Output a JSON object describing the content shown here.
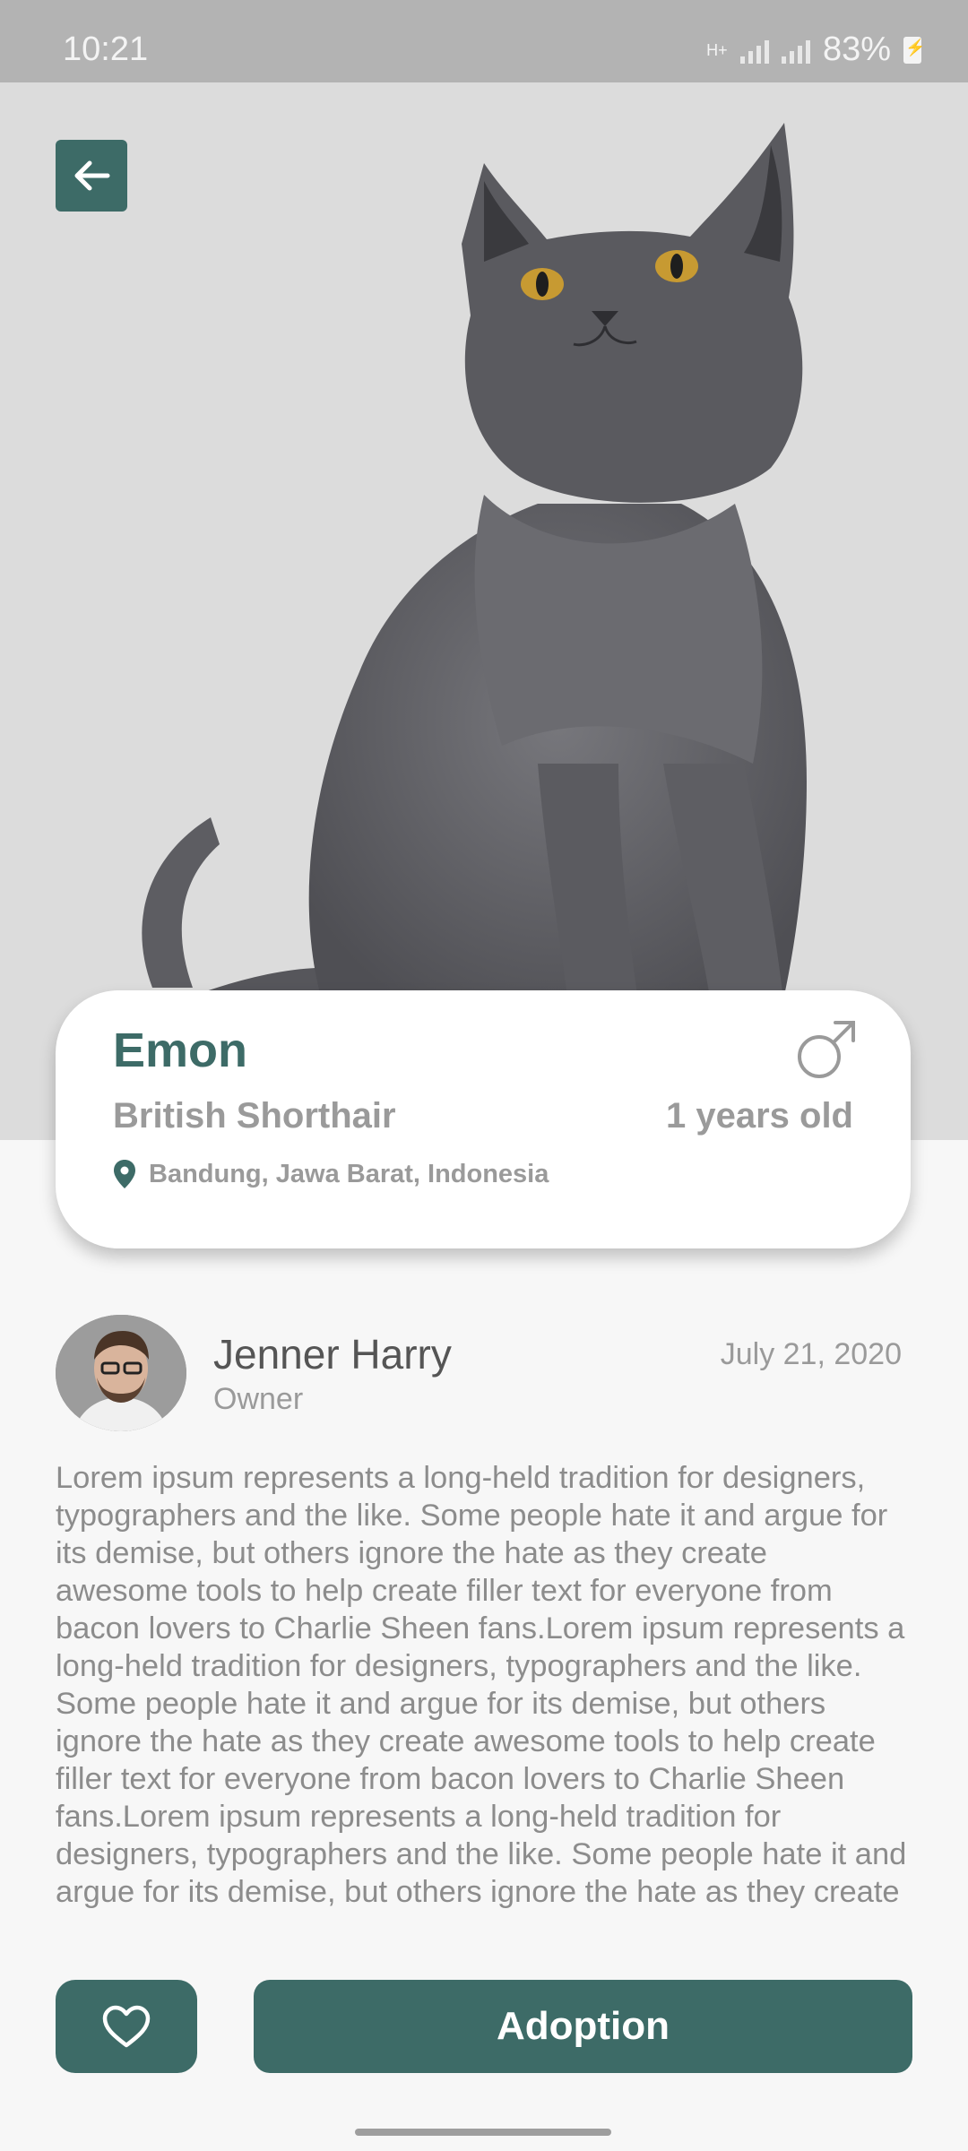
{
  "status_bar": {
    "time": "10:21",
    "network": "H+",
    "battery": "83%"
  },
  "icons": {
    "back": "arrow-left-icon",
    "gender": "male-icon",
    "location": "location-pin-icon",
    "favorite": "heart-icon"
  },
  "pet": {
    "name": "Emon",
    "breed": "British Shorthair",
    "age": "1 years old",
    "location": "Bandung, Jawa Barat, Indonesia"
  },
  "owner": {
    "name": "Jenner Harry",
    "role": "Owner",
    "date": "July 21, 2020"
  },
  "description": "Lorem ipsum represents a long-held tradition for designers, typographers and the like. Some people hate it and argue for its demise, but others ignore the hate as they create awesome tools to help create filler text for everyone from bacon lovers to Charlie Sheen fans.Lorem ipsum represents a long-held tradition for designers, typographers and the like. Some people hate it and argue for its demise, but others ignore the hate as they create awesome tools to help create filler text for everyone from bacon lovers to Charlie Sheen fans.Lorem ipsum represents a long-held tradition for designers, typographers and the like. Some people hate it and argue for its demise, but others ignore the hate as they create",
  "actions": {
    "adopt_label": "Adoption"
  },
  "colors": {
    "accent": "#3d6b67",
    "muted_text": "#9a9a9a",
    "hero_bg": "#dcdcdc"
  }
}
